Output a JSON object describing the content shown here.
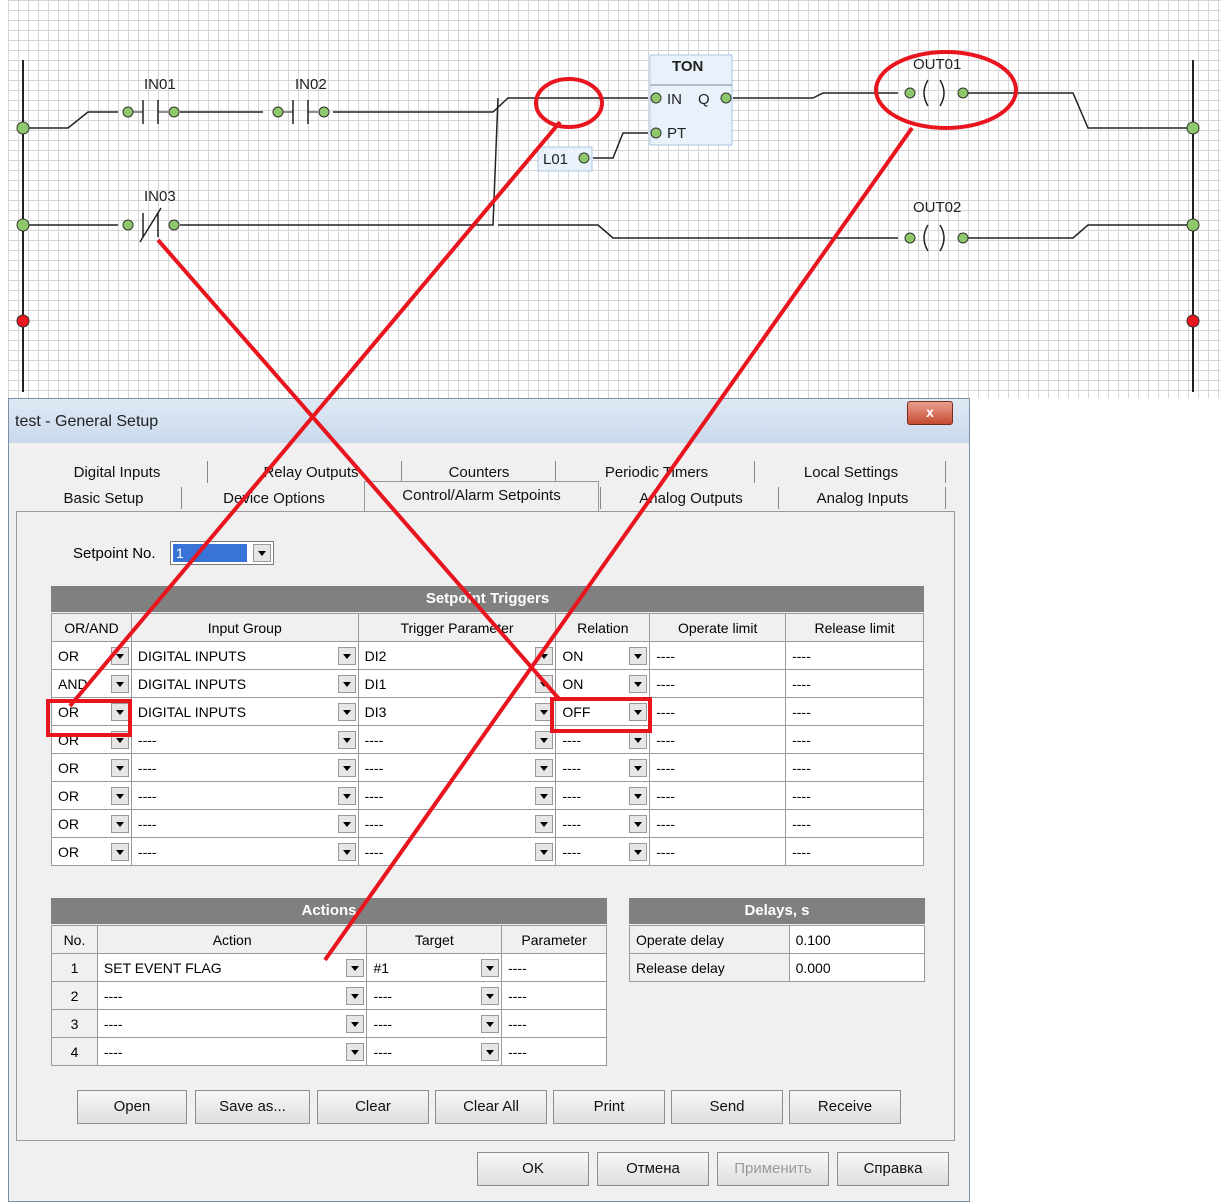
{
  "ladder": {
    "contacts": [
      "IN01",
      "IN02",
      "IN03"
    ],
    "timer": {
      "name": "TON",
      "in": "IN",
      "q": "Q",
      "pt": "PT"
    },
    "constant": "L01",
    "coils": [
      "OUT01",
      "OUT02"
    ]
  },
  "window": {
    "title": "test - General Setup",
    "close": "x"
  },
  "tabs": {
    "row1": [
      "Digital Inputs",
      "Relay Outputs",
      "Counters",
      "Periodic Timers",
      "Local Settings"
    ],
    "row2": [
      "Basic Setup",
      "Device Options",
      "Control/Alarm Setpoints",
      "Analog Outputs",
      "Analog Inputs"
    ]
  },
  "setpoint": {
    "label": "Setpoint No.",
    "value": "1"
  },
  "triggers": {
    "title": "Setpoint Triggers",
    "headers": [
      "OR/AND",
      "Input Group",
      "Trigger Parameter",
      "Relation",
      "Operate limit",
      "Release limit"
    ],
    "rows": [
      [
        "OR",
        "DIGITAL INPUTS",
        "DI2",
        "ON",
        "----",
        "----"
      ],
      [
        "AND",
        "DIGITAL INPUTS",
        "DI1",
        "ON",
        "----",
        "----"
      ],
      [
        "OR",
        "DIGITAL INPUTS",
        "DI3",
        "OFF",
        "----",
        "----"
      ],
      [
        "OR",
        "----",
        "----",
        "----",
        "----",
        "----"
      ],
      [
        "OR",
        "----",
        "----",
        "----",
        "----",
        "----"
      ],
      [
        "OR",
        "----",
        "----",
        "----",
        "----",
        "----"
      ],
      [
        "OR",
        "----",
        "----",
        "----",
        "----",
        "----"
      ],
      [
        "OR",
        "----",
        "----",
        "----",
        "----",
        "----"
      ]
    ]
  },
  "actions": {
    "title": "Actions",
    "headers": [
      "No.",
      "Action",
      "Target",
      "Parameter"
    ],
    "rows": [
      [
        "1",
        "SET EVENT FLAG",
        "#1",
        "----"
      ],
      [
        "2",
        "----",
        "----",
        "----"
      ],
      [
        "3",
        "----",
        "----",
        "----"
      ],
      [
        "4",
        "----",
        "----",
        "----"
      ]
    ]
  },
  "delays": {
    "title": "Delays, s",
    "rows": [
      [
        "Operate delay",
        "0.100"
      ],
      [
        "Release delay",
        "0.000"
      ]
    ]
  },
  "buttons": {
    "panel": [
      "Open",
      "Save as...",
      "Clear",
      "Clear All",
      "Print",
      "Send",
      "Receive"
    ],
    "dialog": [
      "OK",
      "Отмена",
      "Применить",
      "Справка"
    ]
  },
  "colors": {
    "annotation": "#e8141e",
    "contact_green": "#8fc86a",
    "wire": "#222222",
    "grid_header": "#808080"
  }
}
